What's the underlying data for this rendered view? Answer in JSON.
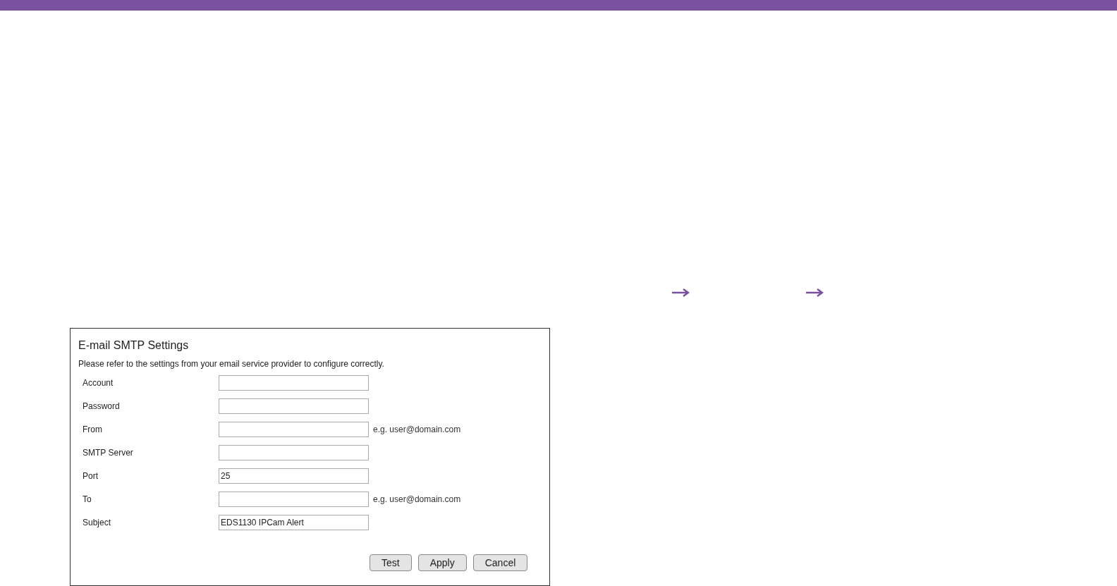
{
  "arrows": [
    {
      "kind": "arrow"
    },
    {
      "kind": "arrow"
    }
  ],
  "panel": {
    "title": "E-mail SMTP Settings",
    "description": "Please refer to the settings from your email service provider to configure correctly.",
    "fields": [
      {
        "label": "Account"
      },
      {
        "label": "Password"
      },
      {
        "label": "From",
        "hint": "e.g. user@domain.com"
      },
      {
        "label": "SMTP Server"
      },
      {
        "label": "Port",
        "value": "25"
      },
      {
        "label": "To",
        "hint": "e.g. user@domain.com"
      },
      {
        "label": "Subject",
        "value": "EDS1130 IPCam Alert"
      }
    ],
    "buttons": [
      "Test",
      "Apply",
      "Cancel"
    ]
  }
}
